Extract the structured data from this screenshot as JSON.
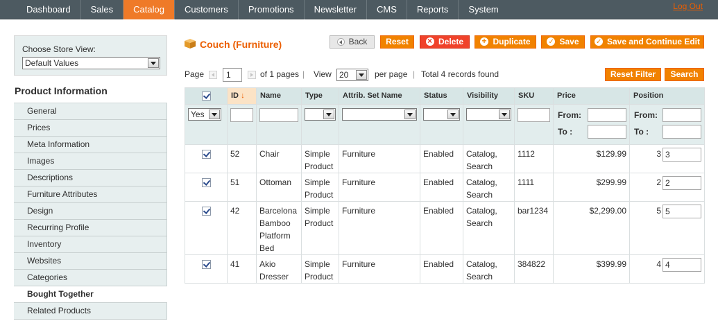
{
  "nav": {
    "tabs": [
      "Dashboard",
      "Sales",
      "Catalog",
      "Customers",
      "Promotions",
      "Newsletter",
      "CMS",
      "Reports",
      "System"
    ],
    "active_tab": "Catalog",
    "logout": "Log Out"
  },
  "store": {
    "label": "Choose Store View:",
    "value": "Default Values"
  },
  "sidebar": {
    "title": "Product Information",
    "items": [
      "General",
      "Prices",
      "Meta Information",
      "Images",
      "Descriptions",
      "Furniture Attributes",
      "Design",
      "Recurring Profile",
      "Inventory",
      "Websites",
      "Categories",
      "Bought Together",
      "Related Products"
    ],
    "active": "Bought Together"
  },
  "page": {
    "title": "Couch (Furniture)"
  },
  "buttons": {
    "back": "Back",
    "reset": "Reset",
    "delete": "Delete",
    "duplicate": "Duplicate",
    "save": "Save",
    "save_continue": "Save and Continue Edit",
    "reset_filter": "Reset Filter",
    "search": "Search"
  },
  "pager": {
    "page_label": "Page",
    "page_value": "1",
    "of_pages": "of 1 pages",
    "view_label": "View",
    "view_value": "20",
    "per_page": "per page",
    "total": "Total 4 records found"
  },
  "grid": {
    "columns": [
      "ID",
      "Name",
      "Type",
      "Attrib. Set Name",
      "Status",
      "Visibility",
      "SKU",
      "Price",
      "Position"
    ],
    "filter": {
      "in_products": "Yes",
      "from_label": "From:",
      "to_label": "To :"
    },
    "rows": [
      {
        "id": "52",
        "name": "Chair",
        "type": "Simple Product",
        "set": "Furniture",
        "status": "Enabled",
        "visibility": "Catalog, Search",
        "sku": "1112",
        "price": "$129.99",
        "pos_text": "3",
        "pos_input": "3"
      },
      {
        "id": "51",
        "name": "Ottoman",
        "type": "Simple Product",
        "set": "Furniture",
        "status": "Enabled",
        "visibility": "Catalog, Search",
        "sku": "1111",
        "price": "$299.99",
        "pos_text": "2",
        "pos_input": "2"
      },
      {
        "id": "42",
        "name": "Barcelona Bamboo Platform Bed",
        "type": "Simple Product",
        "set": "Furniture",
        "status": "Enabled",
        "visibility": "Catalog, Search",
        "sku": "bar1234",
        "price": "$2,299.00",
        "pos_text": "5",
        "pos_input": "5"
      },
      {
        "id": "41",
        "name": "Akio Dresser",
        "type": "Simple Product",
        "set": "Furniture",
        "status": "Enabled",
        "visibility": "Catalog, Search",
        "sku": "384822",
        "price": "$399.99",
        "pos_text": "4",
        "pos_input": "4"
      }
    ]
  },
  "colors": {
    "accent": "#eb5e00",
    "nav_bg": "#4d5a61",
    "button": "#f18200",
    "header_bg": "#d7e6e6"
  }
}
